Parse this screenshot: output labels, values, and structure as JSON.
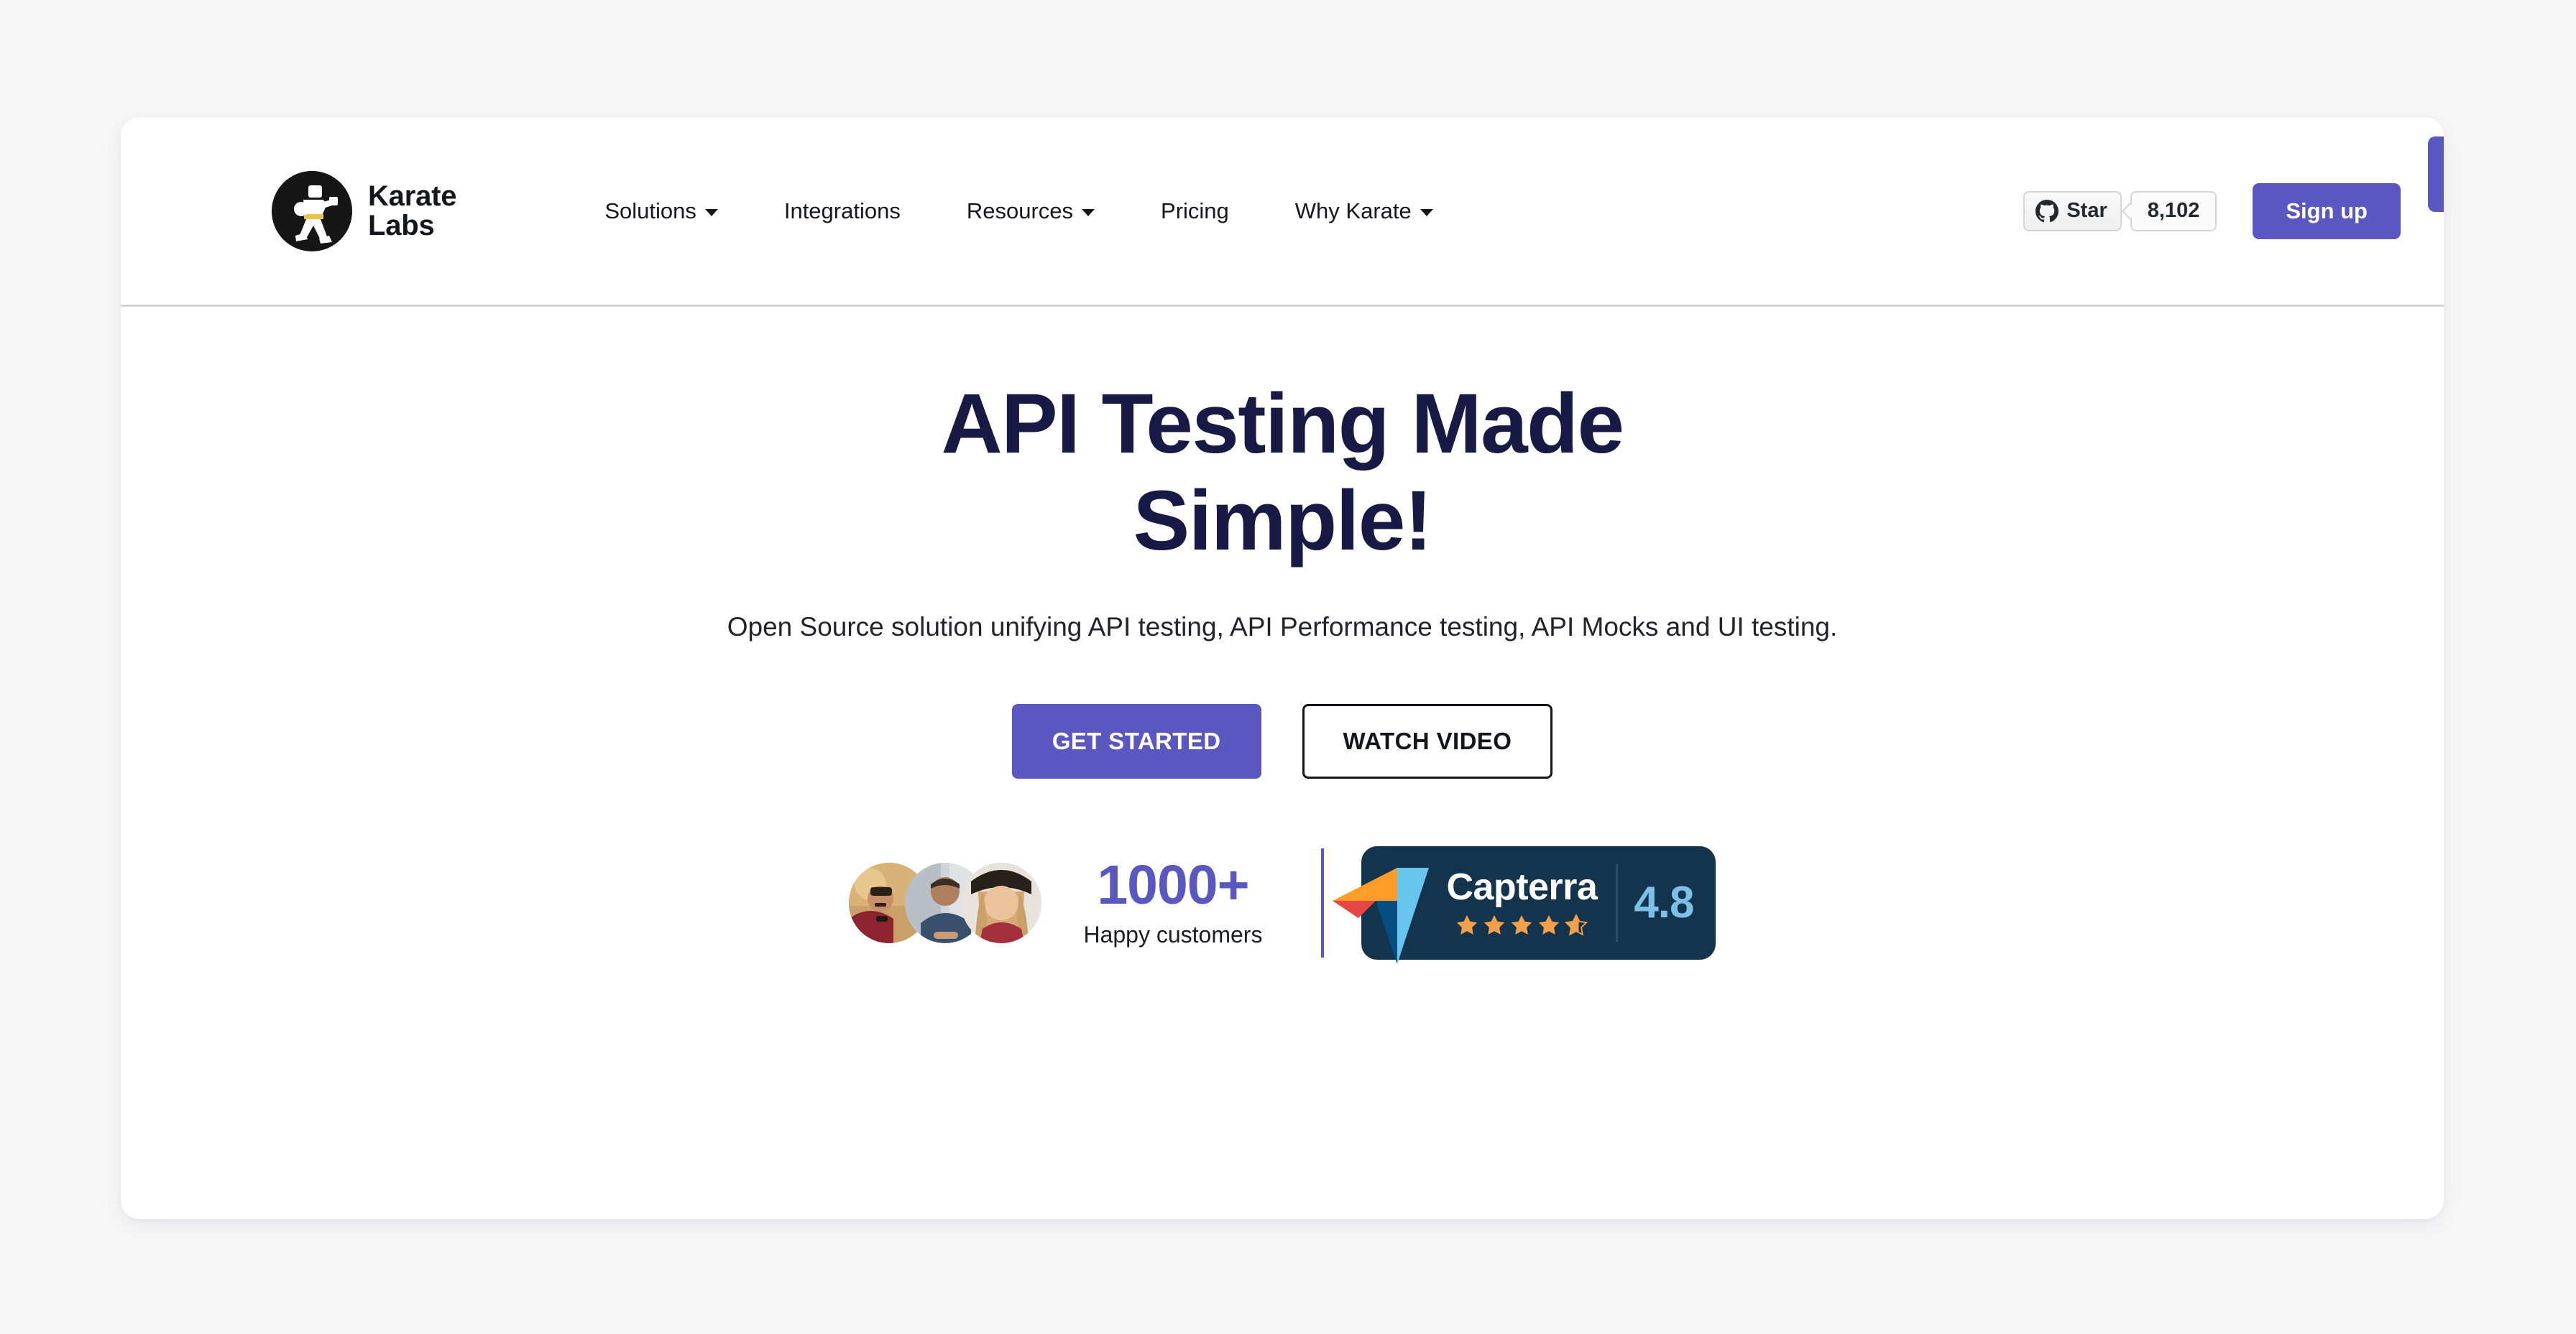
{
  "theme": {
    "page_background": "#f7f7f8",
    "card_background": "#ffffff",
    "accent_purple": "#5a58c0",
    "heading_navy": "#191945",
    "capterra_navy": "#14344d",
    "capterra_score_blue": "#7cc0e8",
    "star_orange": "#f2a04a"
  },
  "header": {
    "brand": {
      "logo_icon": "karate-figure-icon",
      "name_line1": "Karate",
      "name_line2": "Labs"
    },
    "nav": [
      {
        "label": "Solutions",
        "has_dropdown": true
      },
      {
        "label": "Integrations",
        "has_dropdown": false
      },
      {
        "label": "Resources",
        "has_dropdown": true
      },
      {
        "label": "Pricing",
        "has_dropdown": false
      },
      {
        "label": "Why Karate",
        "has_dropdown": true
      }
    ],
    "github": {
      "icon": "github-icon",
      "star_label": "Star",
      "star_count": "8,102"
    },
    "signup_label": "Sign up"
  },
  "hero": {
    "title_line1": "API Testing Made",
    "title_line2": "Simple!",
    "subtitle": "Open Source solution unifying API testing, API Performance testing, API Mocks and UI testing.",
    "primary_cta": "GET STARTED",
    "secondary_cta": "WATCH VIDEO"
  },
  "social_proof": {
    "avatars_count": 3,
    "avatar_icon": "customer-avatar",
    "customers_number": "1000+",
    "customers_label": "Happy customers",
    "capterra": {
      "logo_icon": "capterra-paper-plane-icon",
      "name": "Capterra",
      "rating": "4.8",
      "stars_total": 5,
      "stars_filled": 4.5
    }
  }
}
